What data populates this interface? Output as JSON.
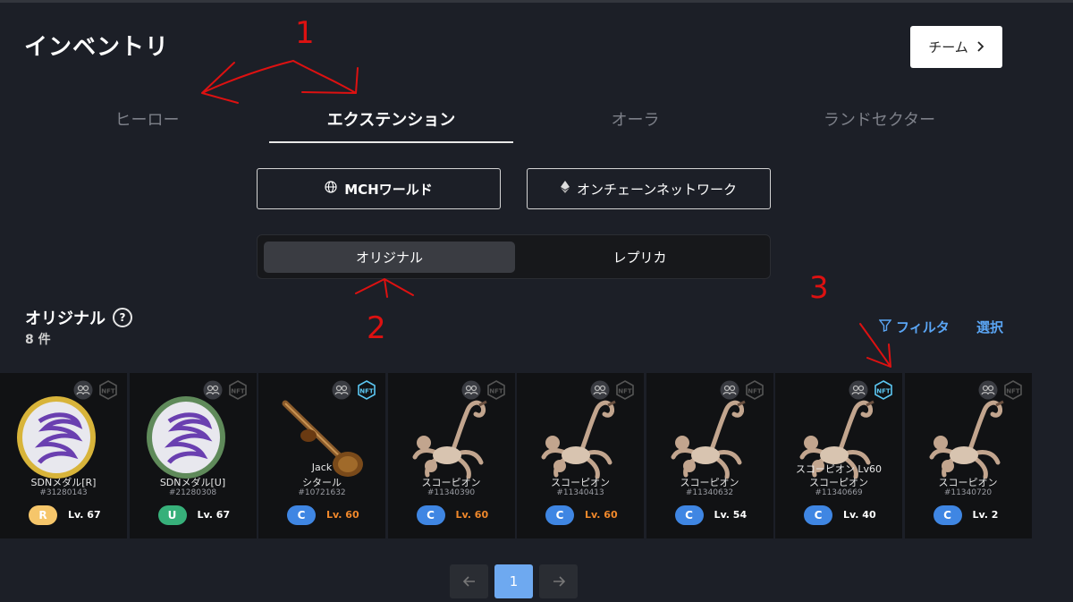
{
  "header": {
    "title": "インベントリ",
    "team_button": "チーム"
  },
  "tabs": [
    {
      "label": "ヒーロー",
      "active": false
    },
    {
      "label": "エクステンション",
      "active": true
    },
    {
      "label": "オーラ",
      "active": false
    },
    {
      "label": "ランドセクター",
      "active": false
    }
  ],
  "network": {
    "mch": "MCHワールド",
    "onchain": "オンチェーンネットワーク"
  },
  "segment": {
    "original": "オリジナル",
    "replica": "レプリカ"
  },
  "section": {
    "title": "オリジナル",
    "help": "?",
    "count": "8 件"
  },
  "actions": {
    "filter": "フィルタ",
    "select": "選択"
  },
  "cards": [
    {
      "kind": "medal-r",
      "name": "SDNメダル[R]",
      "id": "#31280143",
      "rarity": "R",
      "level": "Lv. 67",
      "level_hi": false,
      "nft_active": false
    },
    {
      "kind": "medal-u",
      "name": "SDNメダル[U]",
      "id": "#21280308",
      "rarity": "U",
      "level": "Lv. 67",
      "level_hi": false,
      "nft_active": false
    },
    {
      "kind": "sitar",
      "title": "Jack",
      "name": "シタール",
      "id": "#10721632",
      "rarity": "C",
      "level": "Lv. 60",
      "level_hi": true,
      "nft_active": true
    },
    {
      "kind": "scorpion",
      "name": "スコーピオン",
      "id": "#11340390",
      "rarity": "C",
      "level": "Lv. 60",
      "level_hi": true,
      "nft_active": false
    },
    {
      "kind": "scorpion",
      "name": "スコーピオン",
      "id": "#11340413",
      "rarity": "C",
      "level": "Lv. 60",
      "level_hi": true,
      "nft_active": false
    },
    {
      "kind": "scorpion",
      "name": "スコーピオン",
      "id": "#11340632",
      "rarity": "C",
      "level": "Lv. 54",
      "level_hi": false,
      "nft_active": false
    },
    {
      "kind": "scorpion",
      "title": "スコーピオン Lv60",
      "name": "スコーピオン",
      "id": "#11340669",
      "rarity": "C",
      "level": "Lv. 40",
      "level_hi": false,
      "nft_active": true
    },
    {
      "kind": "scorpion",
      "name": "スコーピオン",
      "id": "#11340720",
      "rarity": "C",
      "level": "Lv. 2",
      "level_hi": false,
      "nft_active": false
    }
  ],
  "rarity_colors": {
    "R": "#f6c66a",
    "U": "#37b07a",
    "C": "#3f86e3"
  },
  "pagination": {
    "current": "1"
  },
  "annotations": [
    "1",
    "2",
    "3"
  ]
}
